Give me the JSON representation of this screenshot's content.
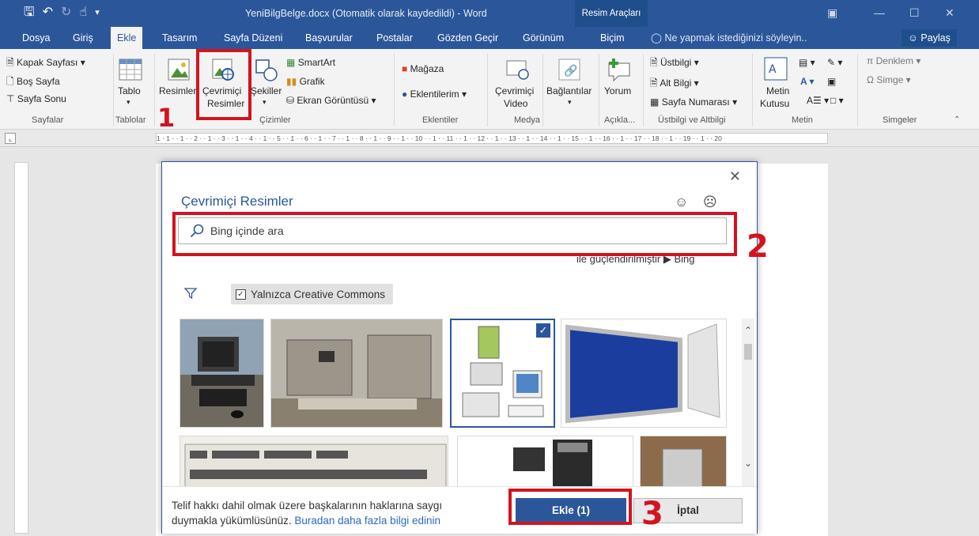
{
  "window": {
    "title": "YeniBilgBelge.docx (Otomatik olarak kaydedildi) - Word",
    "contextual_tools": "Resim Araçları"
  },
  "tabs": [
    "Dosya",
    "Giriş",
    "Ekle",
    "Tasarım",
    "Sayfa Düzeni",
    "Başvurular",
    "Postalar",
    "Gözden Geçir",
    "Görünüm",
    "Biçim"
  ],
  "tellme": "Ne yapmak istediğinizi söyleyin..",
  "share": "Paylaş",
  "ribbon": {
    "pages": {
      "cover": "Kapak Sayfası",
      "blank": "Boş Sayfa",
      "break": "Sayfa Sonu",
      "label": "Sayfalar"
    },
    "tables": {
      "table": "Tablo",
      "label": "Tablolar"
    },
    "illustrations": {
      "pictures": "Resimler",
      "online_pictures_1": "Çevrimiçi",
      "online_pictures_2": "Resimler",
      "shapes": "Şekiller",
      "smartart": "SmartArt",
      "chart": "Grafik",
      "screenshot": "Ekran Görüntüsü",
      "label": "Çizimler"
    },
    "addins": {
      "store": "Mağaza",
      "my_addins": "Eklentilerim",
      "label": "Eklentiler"
    },
    "media": {
      "online_video_1": "Çevrimiçi",
      "online_video_2": "Video",
      "label": "Medya"
    },
    "links": {
      "links": "Bağlantılar"
    },
    "comments": {
      "comment": "Yorum",
      "label": "Açıkla..."
    },
    "header_footer": {
      "header": "Üstbilgi",
      "footer": "Alt Bilgi",
      "page_number": "Sayfa Numarası",
      "label": "Üstbilgi ve Altbilgi"
    },
    "text": {
      "textbox_1": "Metin",
      "textbox_2": "Kutusu",
      "label": "Metin"
    },
    "symbols": {
      "equation": "Denklem",
      "symbol": "Simge",
      "label": "Simgeler"
    }
  },
  "ruler": "1 · 1 · · 1 · · 2 · · 1 · · 3 · · 1 · · 4 · · 1 · · 5 · · 1 · · 6 · · 1 · · 7 · · 1 · · 8 · · 1 · · 9 · · 1 · · 10 · · 1 · · 11 · · 1 · · 12 · · 1 · · 13 · · 1 · · 14 · · 1 · · 15 · · 1 · · 16 · · 1 · · 17 · · 18 · · 1 · · 19 · · 1 · · 20",
  "dialog": {
    "title": "Çevrimiçi Resimler",
    "search_placeholder": "Bing içinde ara",
    "powered_by": "ile güçlendirilmiştir",
    "bing": "Bing",
    "filter_label": "Yalnızca Creative Commons",
    "legal_text": "Telif hakkı dahil olmak üzere başkalarının haklarına saygı duymakla yükümlüsünüz.",
    "legal_link": "Buradan daha fazla bilgi edinin",
    "insert_button": "Ekle (1)",
    "cancel_button": "İptal"
  },
  "annotations": [
    "1",
    "2",
    "3"
  ],
  "colors": {
    "word_blue": "#2b579a",
    "highlight_red": "#d3131f"
  }
}
